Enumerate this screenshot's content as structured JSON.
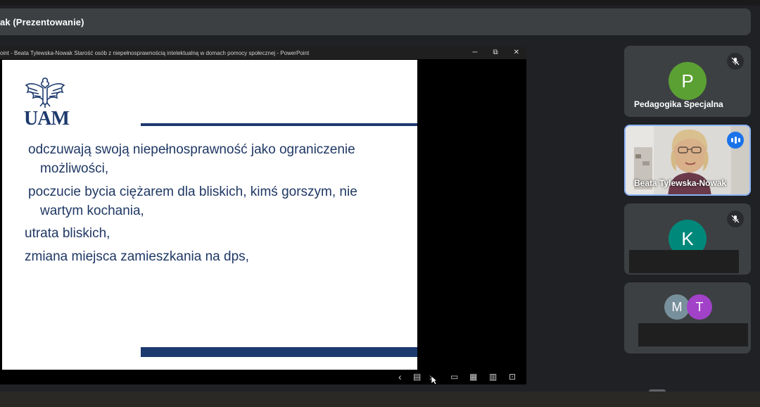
{
  "presenting": {
    "label": "ak (Prezentowanie)"
  },
  "powerpoint": {
    "title": "oint  -  Beata Tylewska-Nowak Starość osób z niepełnosprawnością intelektualną w domach pomocy społecznej - PowerPoint",
    "window_controls": {
      "minimize": "─",
      "restore": "⧉",
      "close": "✕"
    }
  },
  "slide": {
    "logo_text": "UAM",
    "bullets": [
      {
        "line1": "odczuwają swoją niepełnosprawność jako ograniczenie",
        "line2": "możliwości,"
      },
      {
        "line1": "poczucie bycia ciężarem dla bliskich, kimś gorszym, nie",
        "line2": "wartym kochania,"
      },
      {
        "line1": "utrata bliskich,"
      },
      {
        "line1": "zmiana miejsca zamieszkania na dps,"
      }
    ],
    "accent_color": "#1d3a6e"
  },
  "statusbar": {
    "prev": "‹",
    "notes": "▤",
    "next": "›",
    "view_normal": "▭",
    "view_sorter": "▦",
    "view_reading": "▥",
    "view_slideshow": "⊡"
  },
  "participants": [
    {
      "initial": "P",
      "name": "Pedagogika Specjalna",
      "color": "#5ba033",
      "muted": true
    },
    {
      "name": "Beata Tylewska-Nowak",
      "speaking": true
    },
    {
      "initial": "K",
      "color": "#00897b",
      "muted": true
    },
    {
      "initials": [
        "M",
        "T"
      ],
      "colors": [
        "#78909c",
        "#a142c8"
      ]
    }
  ]
}
